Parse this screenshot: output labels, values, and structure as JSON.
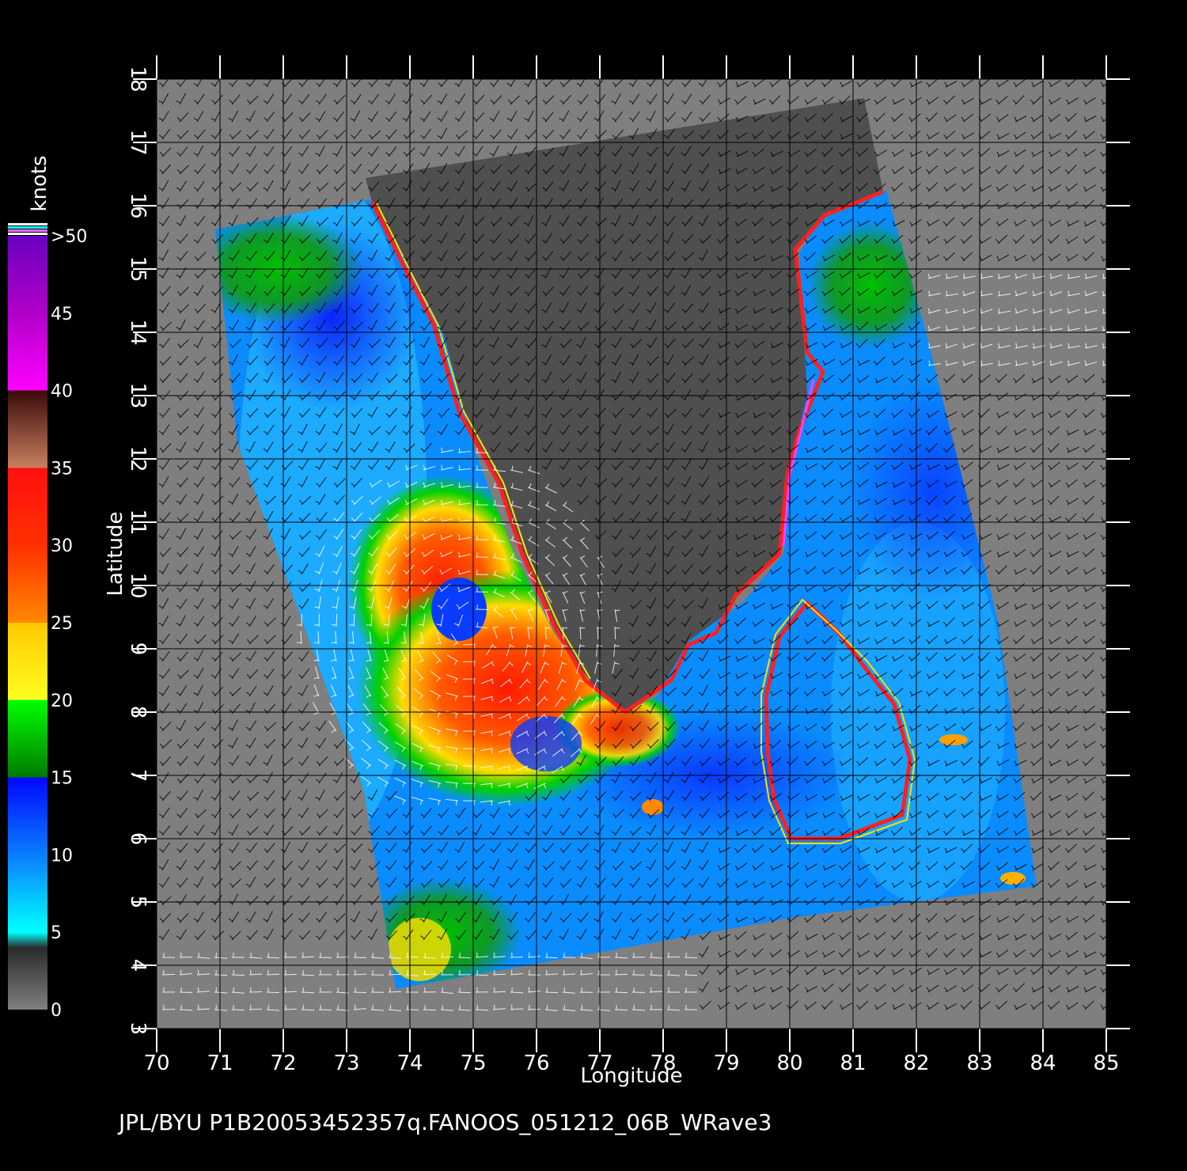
{
  "map": {
    "x_label": "Longitude",
    "y_label": "Latitude",
    "lon_range": [
      70,
      85
    ],
    "lat_range": [
      3,
      18
    ],
    "lon_ticks": [
      "70",
      "71",
      "72",
      "73",
      "74",
      "75",
      "76",
      "77",
      "78",
      "79",
      "80",
      "81",
      "82",
      "83",
      "84",
      "85"
    ],
    "lat_ticks": [
      "3",
      "4",
      "5",
      "6",
      "7",
      "8",
      "9",
      "10",
      "11",
      "12",
      "13",
      "14",
      "15",
      "16",
      "17",
      "18"
    ],
    "grid": true,
    "colors": {
      "background": "#000000",
      "no_data": "#7f7f7f",
      "land": "#4f4f4f",
      "grid": "#000000",
      "text": "#ffffff"
    }
  },
  "colorbar": {
    "unit": "knots",
    "tick_labels": [
      "0",
      "5",
      "10",
      "15",
      "20",
      "25",
      "30",
      "35",
      "40",
      "45",
      ">50"
    ],
    "stops": [
      {
        "value": 0,
        "color": "#808080"
      },
      {
        "value": 4,
        "color": "#2a2a2a"
      },
      {
        "value": 5,
        "color": "#00ffff"
      },
      {
        "value": 10,
        "color": "#0a7dff"
      },
      {
        "value": 15,
        "color": "#0008ff"
      },
      {
        "value": 15.01,
        "color": "#007a00"
      },
      {
        "value": 20,
        "color": "#00ff00"
      },
      {
        "value": 20.01,
        "color": "#ffff20"
      },
      {
        "value": 25,
        "color": "#ffc800"
      },
      {
        "value": 25.01,
        "color": "#ff8800"
      },
      {
        "value": 30,
        "color": "#ff3000"
      },
      {
        "value": 35,
        "color": "#ff1010"
      },
      {
        "value": 35.01,
        "color": "#c88060"
      },
      {
        "value": 40,
        "color": "#3a0a0a"
      },
      {
        "value": 40.01,
        "color": "#ff00ff"
      },
      {
        "value": 45,
        "color": "#b000c8"
      },
      {
        "value": 50,
        "color": "#6a00c0"
      }
    ],
    "overflow_colors": [
      "#ffffff",
      "#00ffff",
      "#ff66ff",
      "#ffffff"
    ]
  },
  "footer": {
    "text": "JPL/BYU  P1B20053452357q.FANOOS_051212_06B_WRave3"
  }
}
